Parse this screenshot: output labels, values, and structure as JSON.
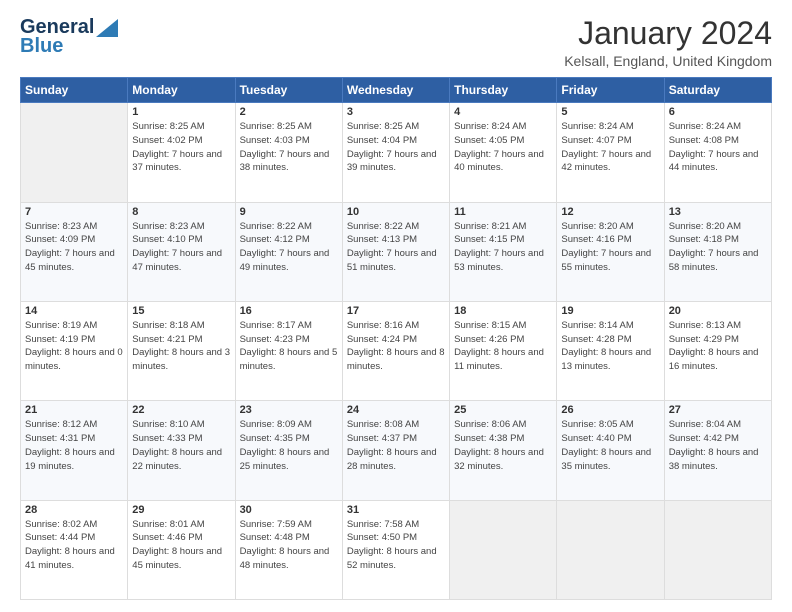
{
  "header": {
    "logo_line1": "General",
    "logo_line2": "Blue",
    "month": "January 2024",
    "location": "Kelsall, England, United Kingdom"
  },
  "days_of_week": [
    "Sunday",
    "Monday",
    "Tuesday",
    "Wednesday",
    "Thursday",
    "Friday",
    "Saturday"
  ],
  "weeks": [
    [
      {
        "day": "",
        "sunrise": "",
        "sunset": "",
        "daylight": ""
      },
      {
        "day": "1",
        "sunrise": "Sunrise: 8:25 AM",
        "sunset": "Sunset: 4:02 PM",
        "daylight": "Daylight: 7 hours and 37 minutes."
      },
      {
        "day": "2",
        "sunrise": "Sunrise: 8:25 AM",
        "sunset": "Sunset: 4:03 PM",
        "daylight": "Daylight: 7 hours and 38 minutes."
      },
      {
        "day": "3",
        "sunrise": "Sunrise: 8:25 AM",
        "sunset": "Sunset: 4:04 PM",
        "daylight": "Daylight: 7 hours and 39 minutes."
      },
      {
        "day": "4",
        "sunrise": "Sunrise: 8:24 AM",
        "sunset": "Sunset: 4:05 PM",
        "daylight": "Daylight: 7 hours and 40 minutes."
      },
      {
        "day": "5",
        "sunrise": "Sunrise: 8:24 AM",
        "sunset": "Sunset: 4:07 PM",
        "daylight": "Daylight: 7 hours and 42 minutes."
      },
      {
        "day": "6",
        "sunrise": "Sunrise: 8:24 AM",
        "sunset": "Sunset: 4:08 PM",
        "daylight": "Daylight: 7 hours and 44 minutes."
      }
    ],
    [
      {
        "day": "7",
        "sunrise": "Sunrise: 8:23 AM",
        "sunset": "Sunset: 4:09 PM",
        "daylight": "Daylight: 7 hours and 45 minutes."
      },
      {
        "day": "8",
        "sunrise": "Sunrise: 8:23 AM",
        "sunset": "Sunset: 4:10 PM",
        "daylight": "Daylight: 7 hours and 47 minutes."
      },
      {
        "day": "9",
        "sunrise": "Sunrise: 8:22 AM",
        "sunset": "Sunset: 4:12 PM",
        "daylight": "Daylight: 7 hours and 49 minutes."
      },
      {
        "day": "10",
        "sunrise": "Sunrise: 8:22 AM",
        "sunset": "Sunset: 4:13 PM",
        "daylight": "Daylight: 7 hours and 51 minutes."
      },
      {
        "day": "11",
        "sunrise": "Sunrise: 8:21 AM",
        "sunset": "Sunset: 4:15 PM",
        "daylight": "Daylight: 7 hours and 53 minutes."
      },
      {
        "day": "12",
        "sunrise": "Sunrise: 8:20 AM",
        "sunset": "Sunset: 4:16 PM",
        "daylight": "Daylight: 7 hours and 55 minutes."
      },
      {
        "day": "13",
        "sunrise": "Sunrise: 8:20 AM",
        "sunset": "Sunset: 4:18 PM",
        "daylight": "Daylight: 7 hours and 58 minutes."
      }
    ],
    [
      {
        "day": "14",
        "sunrise": "Sunrise: 8:19 AM",
        "sunset": "Sunset: 4:19 PM",
        "daylight": "Daylight: 8 hours and 0 minutes."
      },
      {
        "day": "15",
        "sunrise": "Sunrise: 8:18 AM",
        "sunset": "Sunset: 4:21 PM",
        "daylight": "Daylight: 8 hours and 3 minutes."
      },
      {
        "day": "16",
        "sunrise": "Sunrise: 8:17 AM",
        "sunset": "Sunset: 4:23 PM",
        "daylight": "Daylight: 8 hours and 5 minutes."
      },
      {
        "day": "17",
        "sunrise": "Sunrise: 8:16 AM",
        "sunset": "Sunset: 4:24 PM",
        "daylight": "Daylight: 8 hours and 8 minutes."
      },
      {
        "day": "18",
        "sunrise": "Sunrise: 8:15 AM",
        "sunset": "Sunset: 4:26 PM",
        "daylight": "Daylight: 8 hours and 11 minutes."
      },
      {
        "day": "19",
        "sunrise": "Sunrise: 8:14 AM",
        "sunset": "Sunset: 4:28 PM",
        "daylight": "Daylight: 8 hours and 13 minutes."
      },
      {
        "day": "20",
        "sunrise": "Sunrise: 8:13 AM",
        "sunset": "Sunset: 4:29 PM",
        "daylight": "Daylight: 8 hours and 16 minutes."
      }
    ],
    [
      {
        "day": "21",
        "sunrise": "Sunrise: 8:12 AM",
        "sunset": "Sunset: 4:31 PM",
        "daylight": "Daylight: 8 hours and 19 minutes."
      },
      {
        "day": "22",
        "sunrise": "Sunrise: 8:10 AM",
        "sunset": "Sunset: 4:33 PM",
        "daylight": "Daylight: 8 hours and 22 minutes."
      },
      {
        "day": "23",
        "sunrise": "Sunrise: 8:09 AM",
        "sunset": "Sunset: 4:35 PM",
        "daylight": "Daylight: 8 hours and 25 minutes."
      },
      {
        "day": "24",
        "sunrise": "Sunrise: 8:08 AM",
        "sunset": "Sunset: 4:37 PM",
        "daylight": "Daylight: 8 hours and 28 minutes."
      },
      {
        "day": "25",
        "sunrise": "Sunrise: 8:06 AM",
        "sunset": "Sunset: 4:38 PM",
        "daylight": "Daylight: 8 hours and 32 minutes."
      },
      {
        "day": "26",
        "sunrise": "Sunrise: 8:05 AM",
        "sunset": "Sunset: 4:40 PM",
        "daylight": "Daylight: 8 hours and 35 minutes."
      },
      {
        "day": "27",
        "sunrise": "Sunrise: 8:04 AM",
        "sunset": "Sunset: 4:42 PM",
        "daylight": "Daylight: 8 hours and 38 minutes."
      }
    ],
    [
      {
        "day": "28",
        "sunrise": "Sunrise: 8:02 AM",
        "sunset": "Sunset: 4:44 PM",
        "daylight": "Daylight: 8 hours and 41 minutes."
      },
      {
        "day": "29",
        "sunrise": "Sunrise: 8:01 AM",
        "sunset": "Sunset: 4:46 PM",
        "daylight": "Daylight: 8 hours and 45 minutes."
      },
      {
        "day": "30",
        "sunrise": "Sunrise: 7:59 AM",
        "sunset": "Sunset: 4:48 PM",
        "daylight": "Daylight: 8 hours and 48 minutes."
      },
      {
        "day": "31",
        "sunrise": "Sunrise: 7:58 AM",
        "sunset": "Sunset: 4:50 PM",
        "daylight": "Daylight: 8 hours and 52 minutes."
      },
      {
        "day": "",
        "sunrise": "",
        "sunset": "",
        "daylight": ""
      },
      {
        "day": "",
        "sunrise": "",
        "sunset": "",
        "daylight": ""
      },
      {
        "day": "",
        "sunrise": "",
        "sunset": "",
        "daylight": ""
      }
    ]
  ]
}
